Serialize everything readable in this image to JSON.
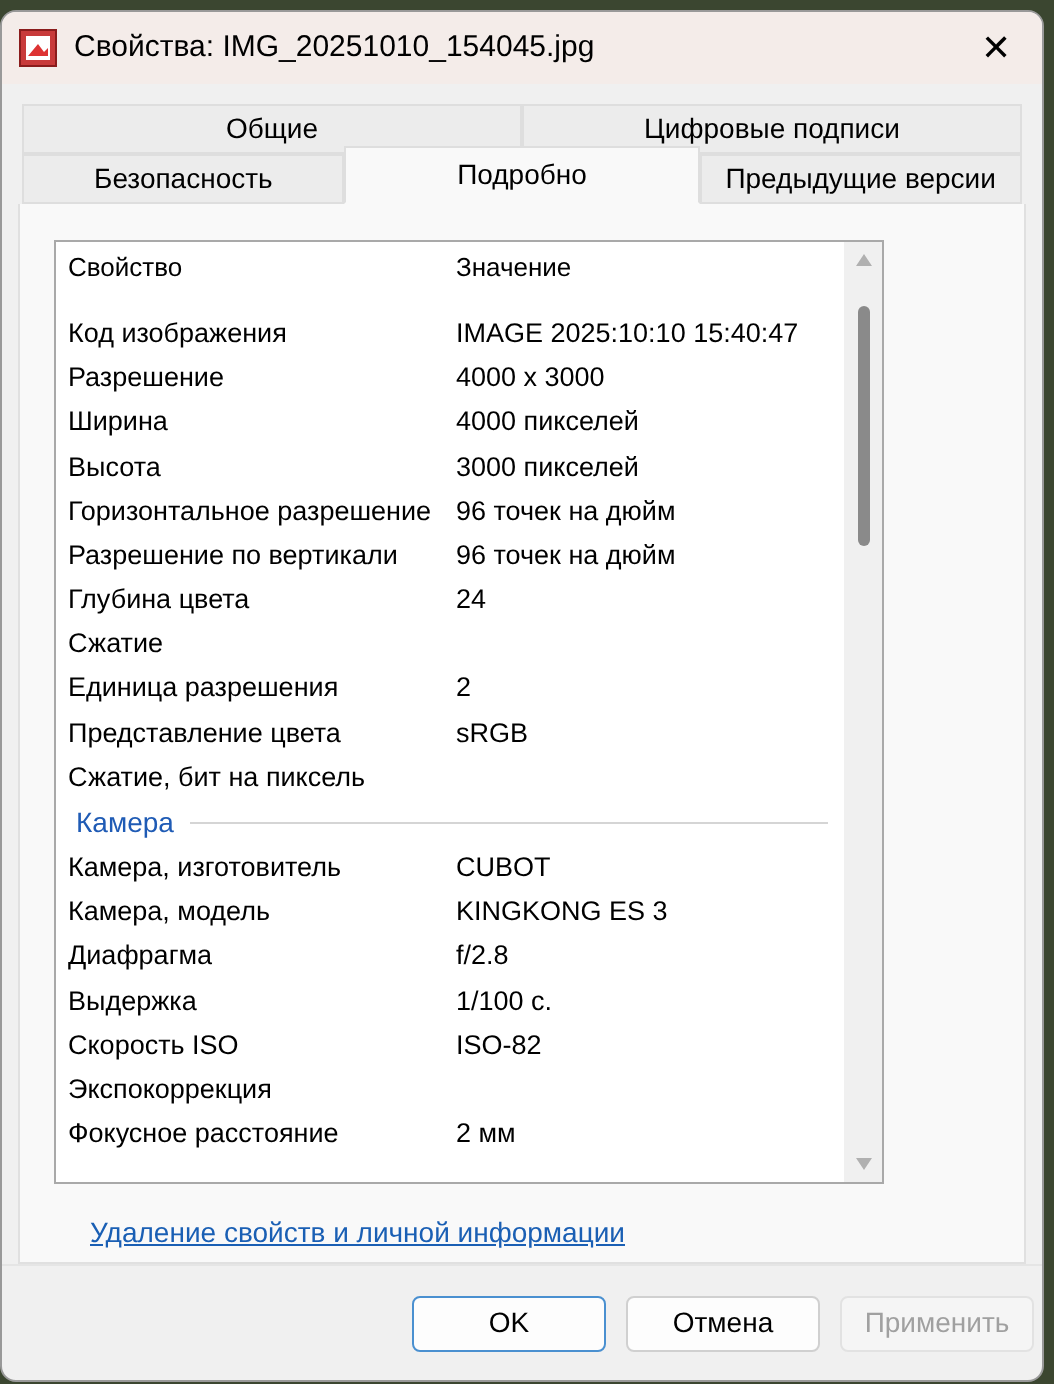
{
  "window": {
    "title": "Свойства: IMG_20251010_154045.jpg",
    "close": "✕"
  },
  "tab_rows": [
    [
      {
        "label": "Общие",
        "selected": false
      },
      {
        "label": "Цифровые подписи",
        "selected": false
      }
    ],
    [
      {
        "label": "Безопасность",
        "selected": false
      },
      {
        "label": "Подробно",
        "selected": true
      },
      {
        "label": "Предыдущие версии",
        "selected": false
      }
    ]
  ],
  "table": {
    "columns": [
      "Свойство",
      "Значение"
    ],
    "rows": [
      {
        "kind": "row",
        "property": "Код изображения",
        "value": "IMAGE 2025:10:10 15:40:47"
      },
      {
        "kind": "row",
        "property": "Разрешение",
        "value": "4000 x 3000"
      },
      {
        "kind": "row",
        "property": "Ширина",
        "value": "4000 пикселей"
      },
      {
        "kind": "row",
        "property": "Высота",
        "value": "3000 пикселей"
      },
      {
        "kind": "row",
        "property": "Горизонтальное разрешение",
        "value": "96 точек на дюйм"
      },
      {
        "kind": "row",
        "property": "Разрешение по вертикали",
        "value": "96 точек на дюйм"
      },
      {
        "kind": "row",
        "property": "Глубина цвета",
        "value": "24"
      },
      {
        "kind": "row",
        "property": "Сжатие"
      },
      {
        "kind": "row",
        "property": "Единица разрешения",
        "value": "2"
      },
      {
        "kind": "row",
        "property": "Представление цвета",
        "value": "sRGB"
      },
      {
        "kind": "row",
        "property": "Сжатие, бит на пиксель"
      },
      {
        "kind": "group",
        "property": "Камера"
      },
      {
        "kind": "row",
        "property": "Камера, изготовитель",
        "value": "CUBOT"
      },
      {
        "kind": "row",
        "property": "Камера, модель",
        "value": "KINGKONG ES 3"
      },
      {
        "kind": "row",
        "property": "Диафрагма",
        "value": "f/2.8"
      },
      {
        "kind": "row",
        "property": "Выдержка",
        "value": "1/100 с."
      },
      {
        "kind": "row",
        "property": "Скорость ISO",
        "value": "ISO-82"
      },
      {
        "kind": "row",
        "property": "Экспокоррекция"
      },
      {
        "kind": "row",
        "property": "Фокусное расстояние",
        "value": "2 мм"
      }
    ]
  },
  "link": "Удаление свойств и личной информации",
  "buttons": [
    {
      "label": "OK",
      "disabled": false,
      "default": true
    },
    {
      "label": "Отмена",
      "disabled": false,
      "default": false
    },
    {
      "label": "Применить",
      "disabled": true,
      "default": false
    }
  ]
}
